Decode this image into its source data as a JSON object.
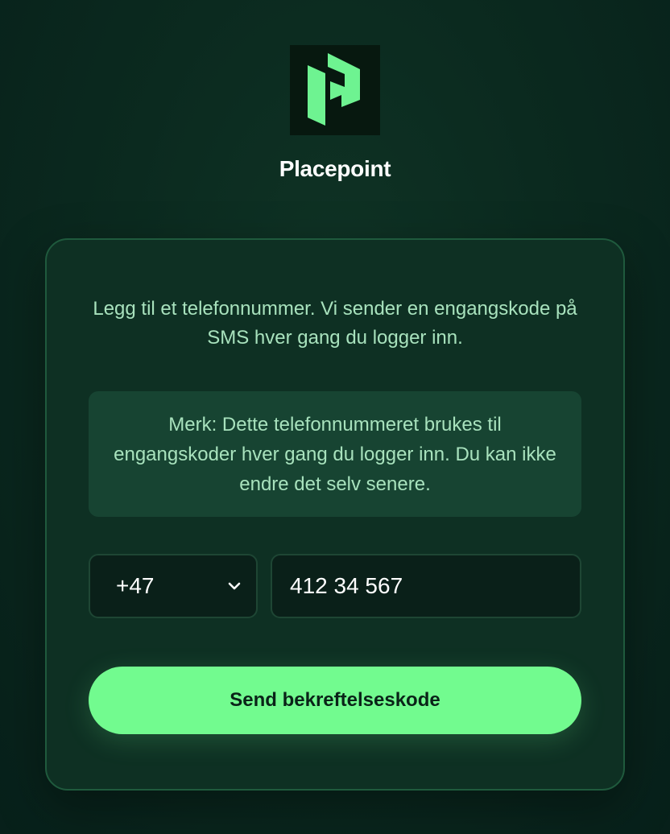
{
  "brand": {
    "name": "Placepoint",
    "logo_icon": "placepoint-logo-icon",
    "logo_color": "#6ef391"
  },
  "card": {
    "intro_text": "Legg til et telefonnummer. Vi sender en engangskode på SMS hver gang du logger inn.",
    "note_text": "Merk: Dette telefonnummeret brukes til engangskoder hver gang du logger inn. Du kan ikke endre det selv senere."
  },
  "form": {
    "country_code": {
      "selected": "+47",
      "icon": "chevron-down-icon"
    },
    "phone": {
      "value": "412 34 567"
    },
    "submit_label": "Send bekreftelseskode"
  },
  "colors": {
    "accent": "#72fb8f",
    "background": "#0b2a1f",
    "card_bg": "#0e3023",
    "note_bg": "#174432",
    "text_muted": "#a8e2bd"
  }
}
